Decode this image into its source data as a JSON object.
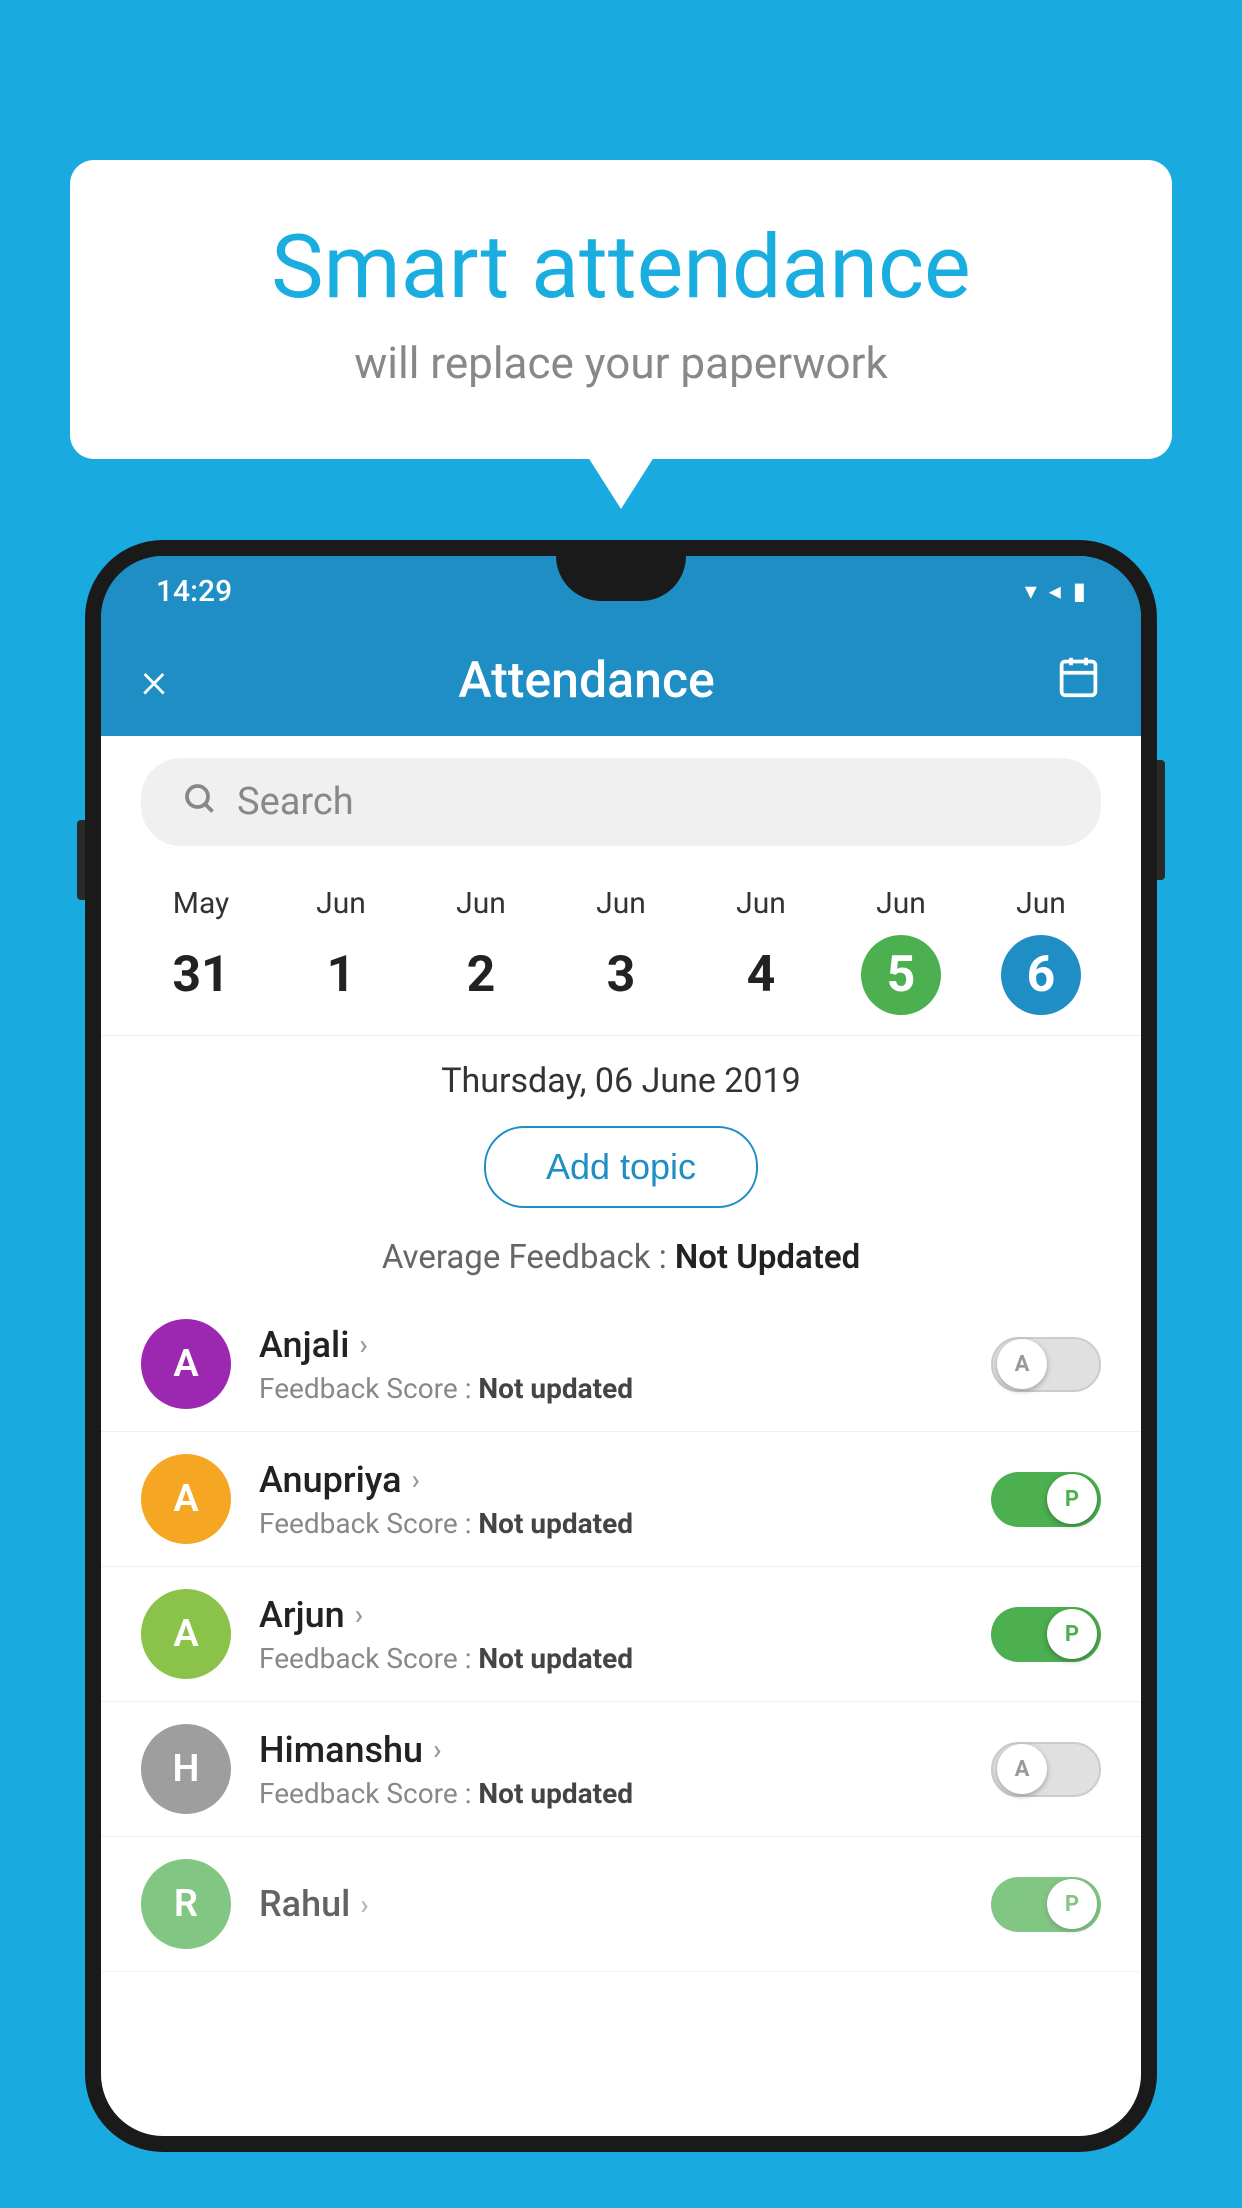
{
  "background_color": "#19AADF",
  "speech_bubble": {
    "title": "Smart attendance",
    "subtitle": "will replace your paperwork"
  },
  "status_bar": {
    "time": "14:29",
    "icons": [
      "wifi",
      "signal",
      "battery"
    ]
  },
  "app_bar": {
    "title": "Attendance",
    "close_label": "×",
    "calendar_label": "📅"
  },
  "search": {
    "placeholder": "Search"
  },
  "calendar": {
    "days": [
      {
        "month": "May",
        "num": "31",
        "state": "normal"
      },
      {
        "month": "Jun",
        "num": "1",
        "state": "normal"
      },
      {
        "month": "Jun",
        "num": "2",
        "state": "normal"
      },
      {
        "month": "Jun",
        "num": "3",
        "state": "normal"
      },
      {
        "month": "Jun",
        "num": "4",
        "state": "normal"
      },
      {
        "month": "Jun",
        "num": "5",
        "state": "today"
      },
      {
        "month": "Jun",
        "num": "6",
        "state": "selected"
      }
    ]
  },
  "selected_date": "Thursday, 06 June 2019",
  "add_topic_label": "Add topic",
  "avg_feedback": {
    "label": "Average Feedback : ",
    "value": "Not Updated"
  },
  "students": [
    {
      "name": "Anjali",
      "avatar_letter": "A",
      "avatar_color": "#9C27B0",
      "feedback_label": "Feedback Score : ",
      "feedback_value": "Not updated",
      "toggle_state": "off",
      "toggle_label": "A"
    },
    {
      "name": "Anupriya",
      "avatar_letter": "A",
      "avatar_color": "#F5A623",
      "feedback_label": "Feedback Score : ",
      "feedback_value": "Not updated",
      "toggle_state": "on",
      "toggle_label": "P"
    },
    {
      "name": "Arjun",
      "avatar_letter": "A",
      "avatar_color": "#8BC34A",
      "feedback_label": "Feedback Score : ",
      "feedback_value": "Not updated",
      "toggle_state": "on",
      "toggle_label": "P"
    },
    {
      "name": "Himanshu",
      "avatar_letter": "H",
      "avatar_color": "#9E9E9E",
      "feedback_label": "Feedback Score : ",
      "feedback_value": "Not updated",
      "toggle_state": "off",
      "toggle_label": "A"
    }
  ]
}
